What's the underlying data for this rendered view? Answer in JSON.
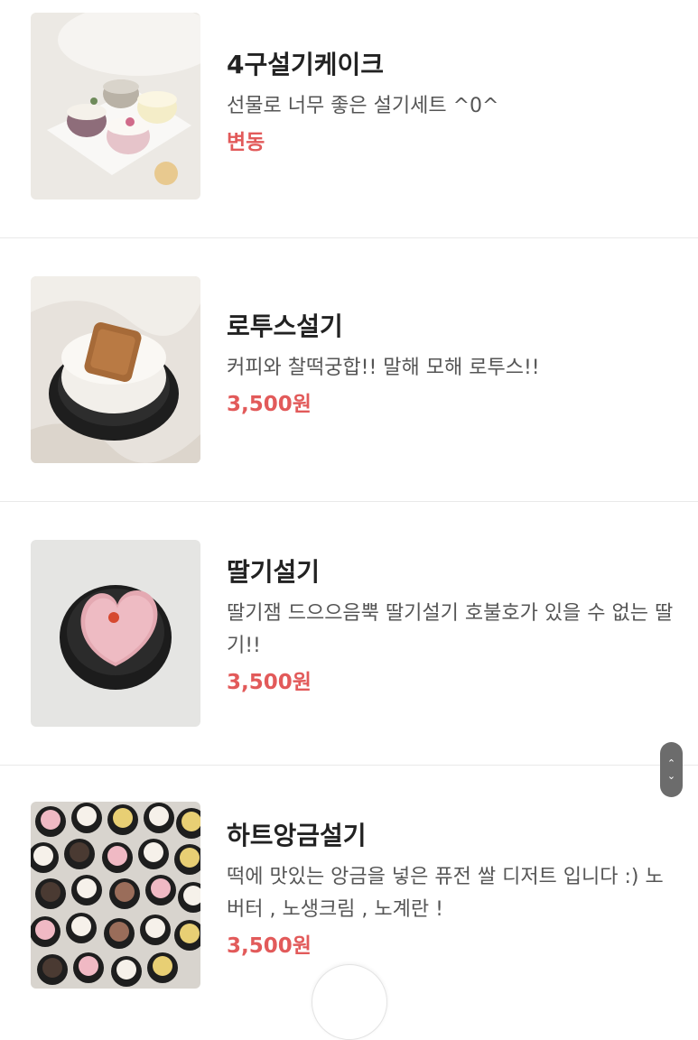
{
  "menu": {
    "items": [
      {
        "name": "4구설기케이크",
        "description": "선물로 너무 좋은 설기세트 ^0^",
        "price": "변동",
        "image_icon": "cake-photo-icon"
      },
      {
        "name": "로투스설기",
        "description": "커피와 찰떡궁합!! 말해 모해 로투스!!",
        "price": "3,500원",
        "image_icon": "cake-photo-icon"
      },
      {
        "name": "딸기설기",
        "description": "딸기잼 드으으음뿍 딸기설기 호불호가 있을 수 없는 딸기!!",
        "price": "3,500원",
        "image_icon": "cake-photo-icon"
      },
      {
        "name": "하트앙금설기",
        "description": "떡에 맛있는 앙금을 넣은 퓨전 쌀 디저트 입니다 :) 노 버터 , 노생크림 , 노계란 !",
        "price": "3,500원",
        "image_icon": "cake-photo-icon"
      }
    ]
  },
  "scroll_control": {
    "up_icon": "chevron-up-icon",
    "down_icon": "chevron-down-icon",
    "up_glyph": "⌃",
    "down_glyph": "⌄"
  },
  "colors": {
    "price": "#e25a5a",
    "title": "#222222",
    "description": "#555555",
    "divider": "#e9e9e9"
  }
}
